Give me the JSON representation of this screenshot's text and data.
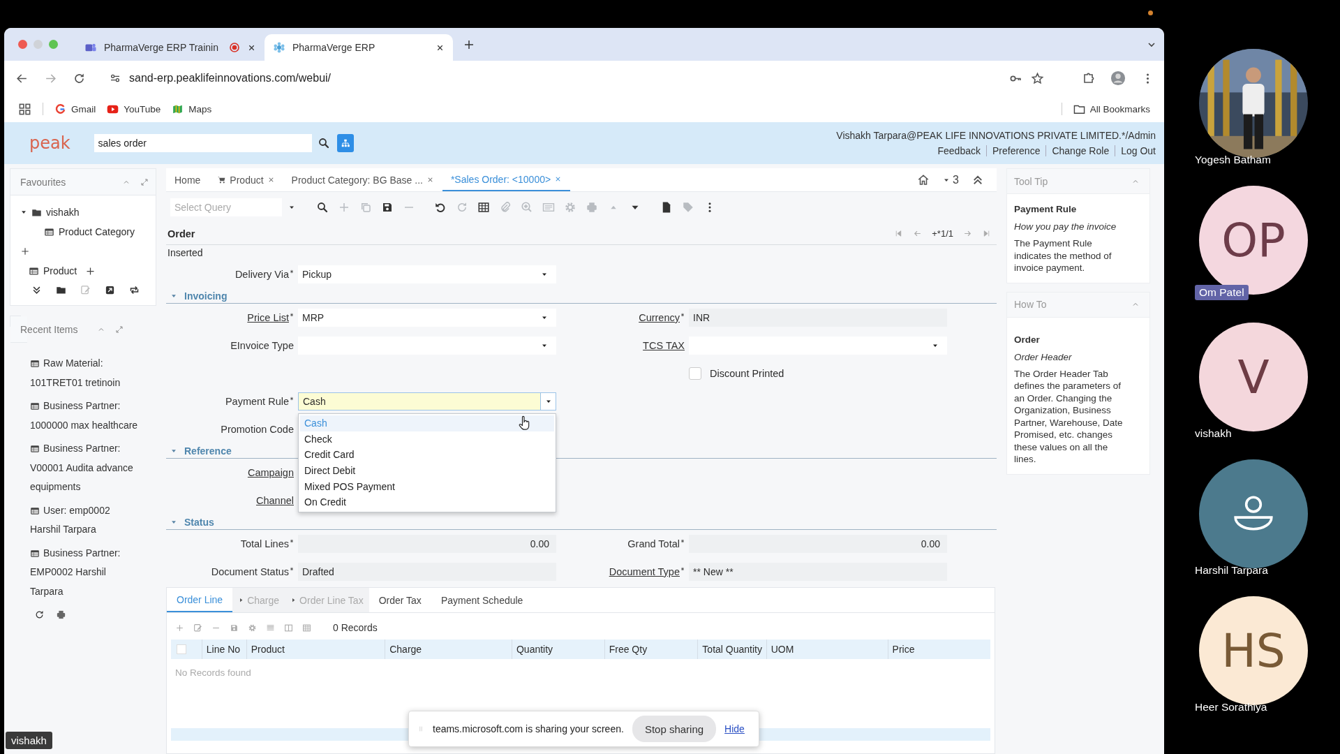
{
  "browser": {
    "tabs": [
      {
        "title": "PharmaVerge ERP Trainin",
        "selected": false,
        "recording": true,
        "kind": "meeting"
      },
      {
        "title": "PharmaVerge ERP",
        "selected": true,
        "recording": false,
        "kind": "app"
      }
    ],
    "url": "sand-erp.peaklifeinnovations.com/webui/",
    "bookmarks": [
      {
        "label": "Gmail",
        "kind": "g-logo"
      },
      {
        "label": "YouTube",
        "kind": "play"
      },
      {
        "label": "Maps",
        "kind": "map"
      }
    ],
    "all_bookmarks": "All Bookmarks"
  },
  "app_header": {
    "logo": "peak",
    "search": {
      "value": "sales order"
    },
    "user": "Vishakh Tarpara@PEAK LIFE INNOVATIONS PRIVATE LIMITED.*/Admin",
    "links": [
      "Feedback",
      "Preference",
      "Change Role",
      "Log Out"
    ]
  },
  "favourites": {
    "title": "Favourites",
    "items": [
      {
        "label": "vishakh",
        "kind": "folder",
        "expanded": true,
        "children": [
          {
            "label": "Product Category",
            "kind": "window"
          }
        ]
      },
      {
        "label": "Product",
        "kind": "window"
      }
    ]
  },
  "recent_items": {
    "title": "Recent Items",
    "items": [
      "Raw Material: 101TRET01 tretinoin",
      "Business Partner: 1000000 max healthcare",
      "Business Partner: V00001 Audita advance equipments",
      "User: emp0002 Harshil Tarpara",
      "Business Partner: EMP0002 Harshil Tarpara"
    ]
  },
  "window_tabs": [
    {
      "label": "Home",
      "selected": false,
      "closable": false,
      "kind": "plain"
    },
    {
      "label": "Product",
      "selected": false,
      "closable": true,
      "kind": "cart"
    },
    {
      "label": "Product Category: BG Base ...",
      "selected": false,
      "closable": true,
      "kind": "plain"
    },
    {
      "label": "*Sales Order: <10000>",
      "selected": true,
      "closable": true,
      "kind": "plain"
    }
  ],
  "tab_count": "3",
  "query": {
    "placeholder": "Select Query"
  },
  "toolbar": [
    {
      "kind": "search",
      "disabled": false
    },
    {
      "kind": "plus",
      "disabled": true
    },
    {
      "kind": "copy",
      "disabled": true
    },
    {
      "kind": "floppy-disk",
      "disabled": false
    },
    {
      "kind": "minus",
      "disabled": true
    },
    {
      "kind": "undo",
      "disabled": false
    },
    {
      "kind": "refresh",
      "disabled": true
    },
    {
      "kind": "table",
      "disabled": false
    },
    {
      "kind": "paperclip",
      "disabled": true
    },
    {
      "kind": "zoom-in",
      "disabled": true
    },
    {
      "kind": "card",
      "disabled": true
    },
    {
      "kind": "settings",
      "disabled": true
    },
    {
      "kind": "printer",
      "disabled": true
    },
    {
      "kind": "caret-up",
      "disabled": true
    },
    {
      "kind": "caret-down",
      "disabled": false
    },
    {
      "kind": "document",
      "disabled": false
    },
    {
      "kind": "tag",
      "disabled": true
    },
    {
      "kind": "more",
      "disabled": false
    }
  ],
  "record": {
    "title": "Order",
    "position": "+*1/1",
    "status": "Inserted"
  },
  "top_fields": [
    {
      "label": "Delivery Via",
      "required": true,
      "link": false,
      "kind": "dropdown",
      "value": "Pickup"
    }
  ],
  "sections": [
    {
      "title": "Invoicing",
      "expanded": true,
      "rows": [
        [
          {
            "label": "Price List",
            "required": true,
            "link": true,
            "kind": "dropdown",
            "value": "MRP"
          },
          {
            "label": "Currency",
            "required": true,
            "link": true,
            "kind": "readonly",
            "value": "INR"
          }
        ],
        [
          {
            "label": "EInvoice Type",
            "required": false,
            "link": false,
            "kind": "dropdown"
          },
          {
            "label": "TCS TAX",
            "required": false,
            "link": true,
            "kind": "dropdown"
          }
        ],
        [
          null,
          {
            "label": "Discount Printed",
            "kind": "checkbox",
            "checked": false
          }
        ],
        [
          {
            "label": "Payment Rule",
            "required": true,
            "link": false,
            "kind": "dropdown",
            "value": "Cash",
            "focused": true,
            "open": true
          },
          null
        ],
        [
          {
            "label": "Promotion Code",
            "required": false,
            "link": false
          },
          null
        ]
      ]
    },
    {
      "title": "Reference",
      "expanded": true,
      "rows": [
        [
          {
            "label": "Campaign",
            "required": false,
            "link": true
          },
          null
        ],
        [
          {
            "label": "Channel",
            "required": false,
            "link": true
          },
          null
        ]
      ]
    },
    {
      "title": "Status",
      "expanded": true,
      "rows": [
        [
          {
            "label": "Total Lines",
            "required": true,
            "link": false,
            "kind": "amount",
            "value": "0.00"
          },
          {
            "label": "Grand Total",
            "required": true,
            "link": false,
            "kind": "amount",
            "value": "0.00"
          }
        ],
        [
          {
            "label": "Document Status",
            "required": true,
            "link": false,
            "kind": "readonly",
            "value": "Drafted"
          },
          {
            "label": "Document Type",
            "required": true,
            "link": true,
            "kind": "readonly",
            "value": "** New **"
          }
        ]
      ]
    }
  ],
  "detail_tabs": [
    {
      "label": "Order Line",
      "selected": true,
      "disabled": false,
      "kind": "plain"
    },
    {
      "label": "Charge",
      "selected": false,
      "disabled": true,
      "kind": "nested"
    },
    {
      "label": "Order Line Tax",
      "selected": false,
      "disabled": true,
      "kind": "nested"
    },
    {
      "label": "Order Tax",
      "selected": false,
      "disabled": false,
      "kind": "plain"
    },
    {
      "label": "Payment Schedule",
      "selected": false,
      "disabled": false,
      "kind": "plain"
    }
  ],
  "open_dropdown": {
    "options": [
      {
        "label": "Cash",
        "selected": true
      },
      {
        "label": "Check",
        "selected": false
      },
      {
        "label": "Credit Card",
        "selected": false
      },
      {
        "label": "Direct Debit",
        "selected": false
      },
      {
        "label": "Mixed POS Payment",
        "selected": false
      },
      {
        "label": "On Credit",
        "selected": false
      }
    ]
  },
  "record_count": "0 Records",
  "grid": {
    "select_all": {
      "checked": false
    },
    "columns": [
      "Line No",
      "Product",
      "Charge",
      "Quantity",
      "Free Qty",
      "Total Quantity",
      "UOM",
      "Price"
    ],
    "empty": "No Records found"
  },
  "share_bar": {
    "message": "teams.microsoft.com is sharing your screen.",
    "stop": "Stop sharing",
    "hide": "Hide"
  },
  "help": [
    {
      "title": "Tool Tip",
      "expanded": true,
      "heading": "Payment Rule",
      "subtitle": "How you pay the invoice",
      "body": "The Payment Rule indicates the method of invoice payment."
    },
    {
      "title": "How To",
      "expanded": true,
      "heading": "Order",
      "subtitle": "Order Header",
      "body": "The Order Header Tab defines the parameters of an Order. Changing the Organization, Business Partner, Warehouse, Date Promised, etc. changes these values on all the lines."
    }
  ],
  "participants": [
    {
      "name": "Yogesh Batham",
      "kind": "picture",
      "highlighted": false
    },
    {
      "name": "Om Patel",
      "kind": "initials",
      "initials": "OP",
      "color": "#f4d7df",
      "highlighted": true
    },
    {
      "name": "vishakh",
      "kind": "initials",
      "initials": "V",
      "color": "#f4d7dc",
      "highlighted": false
    },
    {
      "name": "Harshil Tarpara",
      "kind": "person",
      "color": "#4c7a8d",
      "highlighted": false
    },
    {
      "name": "Heer Sorathiya",
      "kind": "initials",
      "initials": "HS",
      "color": "#fbe9d4",
      "highlighted": false
    }
  ],
  "presenter": "vishakh"
}
